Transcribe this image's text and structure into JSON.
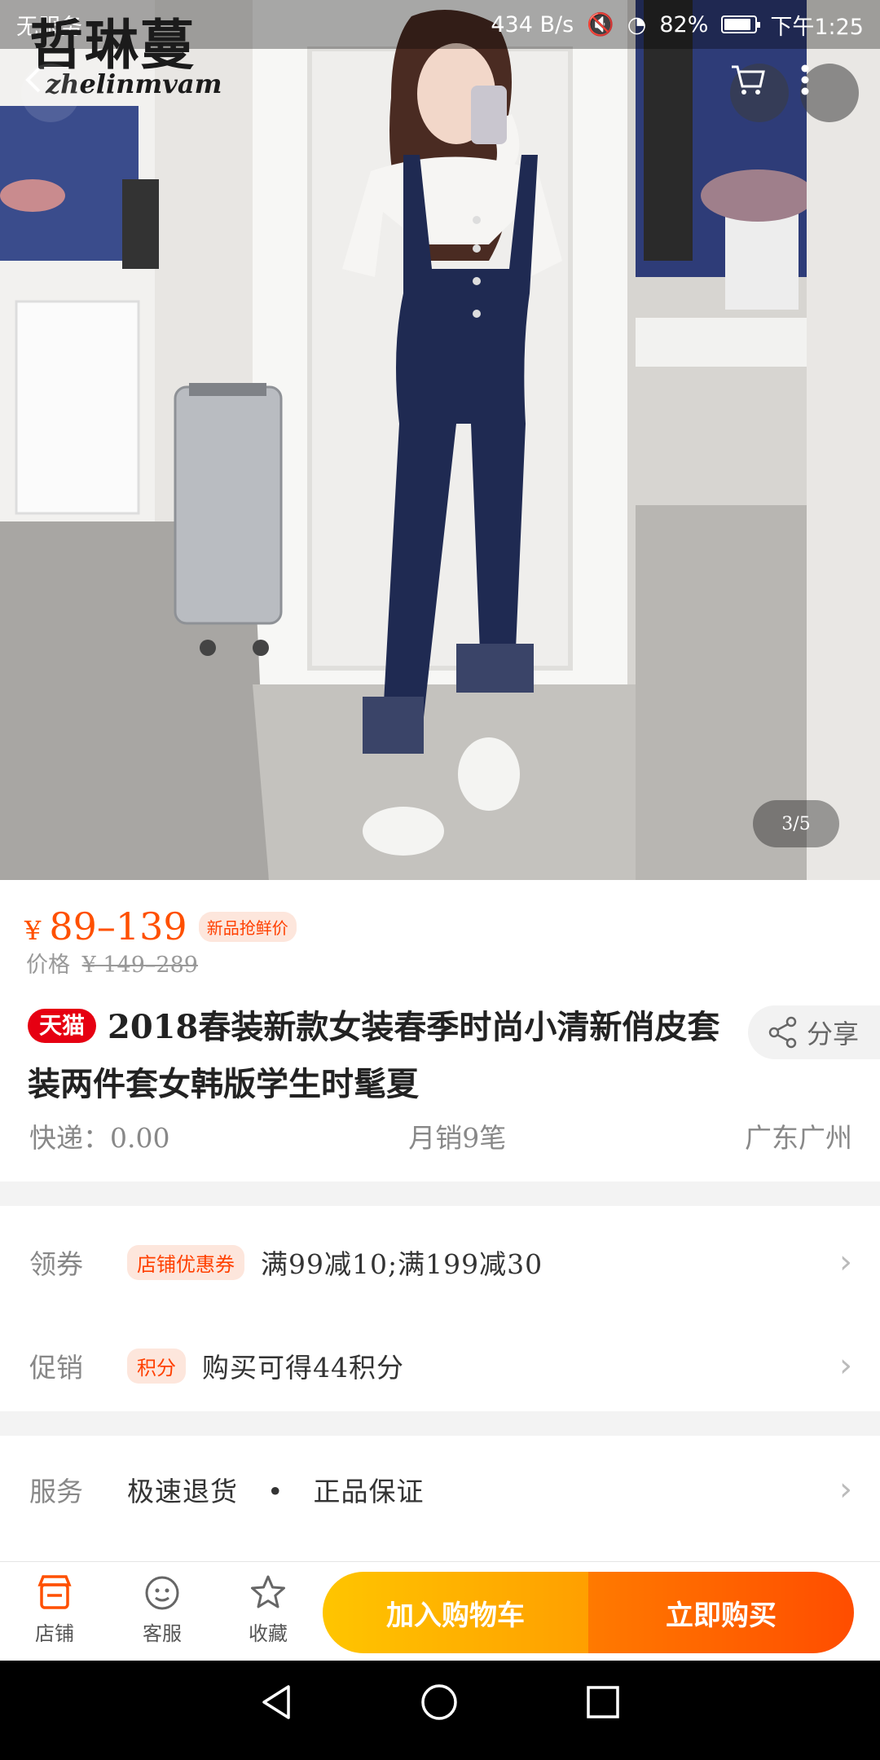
{
  "status_bar": {
    "carrier": "无服务",
    "speed": "434 B/s",
    "battery": "82%",
    "time": "下午1:25"
  },
  "brand": {
    "name_cn": "哲琳蔓",
    "name_en": "zhelinmvam"
  },
  "gallery": {
    "pager": "3/5"
  },
  "price": {
    "currency": "¥",
    "range": "89–139",
    "tag": "新品抢鲜价",
    "original_label": "价格",
    "original_value": "¥ 149–289"
  },
  "product": {
    "platform_badge": "天猫",
    "title": "2018春装新款女装春季时尚小清新俏皮套装两件套女韩版学生时髦夏",
    "share_label": "分享"
  },
  "meta": {
    "shipping": "快递：0.00",
    "monthly_sales": "月销9笔",
    "location": "广东广州"
  },
  "coupon": {
    "label": "领券",
    "chip": "店铺优惠券",
    "text": "满99减10;满199减30"
  },
  "promotion": {
    "label": "促销",
    "chip": "积分",
    "text": "购买可得44积分"
  },
  "service": {
    "label": "服务",
    "item1": "极速退货",
    "item2": "正品保证"
  },
  "action_bar": {
    "shop": "店铺",
    "customer_service": "客服",
    "favorite": "收藏",
    "add_to_cart": "加入购物车",
    "buy_now": "立即购买"
  },
  "colors": {
    "accent": "#ff5000",
    "tmall_red": "#e60012",
    "cart_yellow": "#ffb400",
    "buy_orange": "#ff5a00"
  }
}
